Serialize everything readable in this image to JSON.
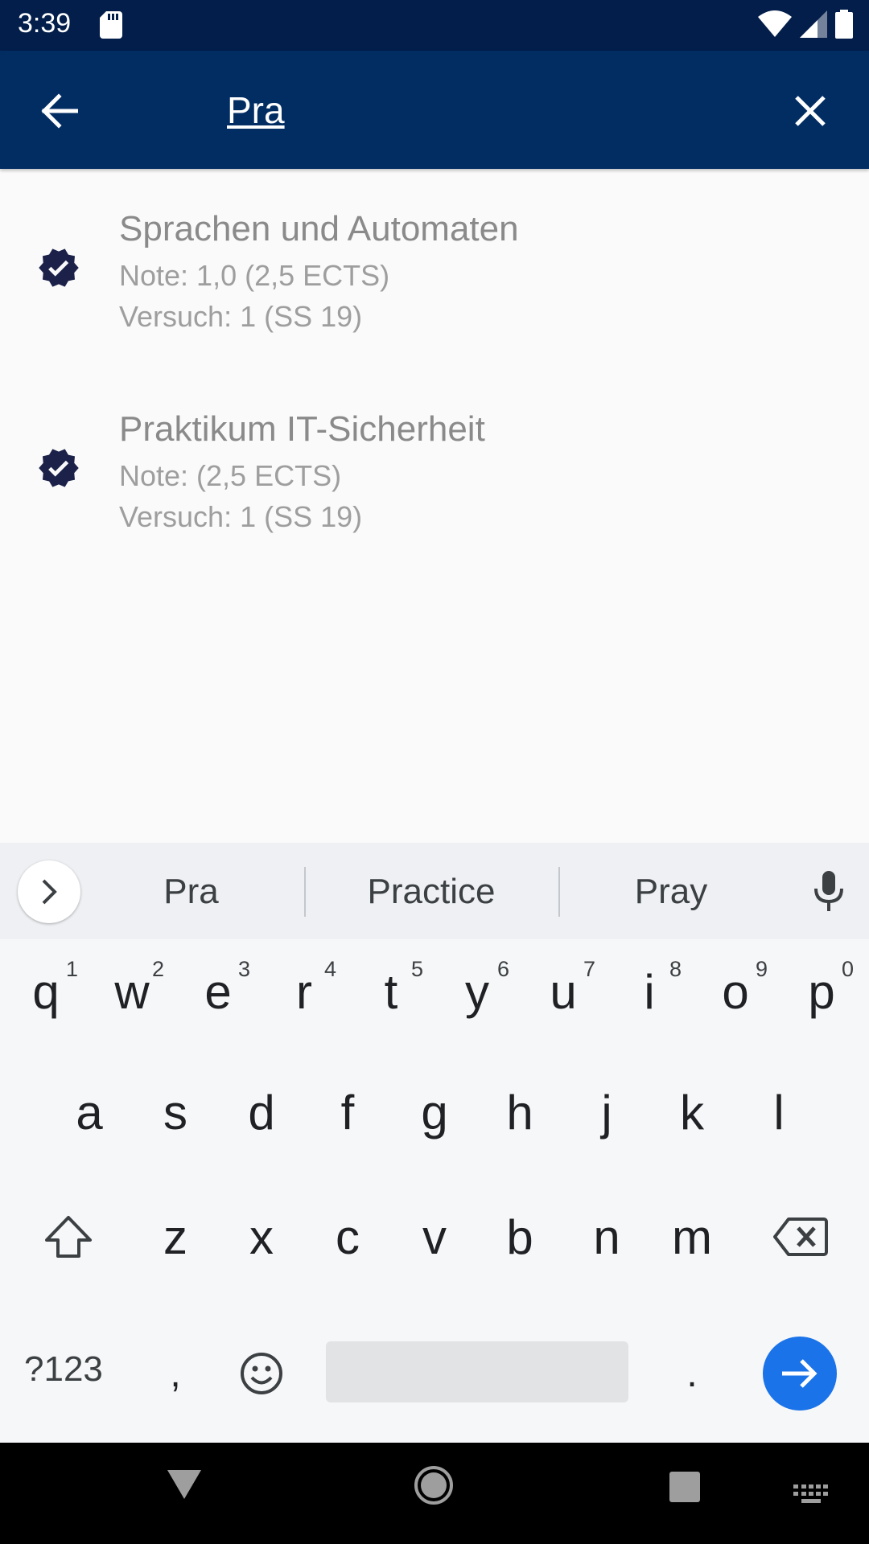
{
  "status_bar": {
    "time": "3:39"
  },
  "search": {
    "value": "Pra"
  },
  "results": [
    {
      "title": "Sprachen und Automaten",
      "grade": "Note: 1,0 (2,5 ECTS)",
      "attempt": "Versuch: 1 (SS 19)"
    },
    {
      "title": "Praktikum IT-Sicherheit",
      "grade": "Note:  (2,5 ECTS)",
      "attempt": "Versuch: 1 (SS 19)"
    }
  ],
  "suggestions": [
    "Pra",
    "Practice",
    "Pray"
  ],
  "keyboard": {
    "row1": [
      {
        "key": "q",
        "num": "1"
      },
      {
        "key": "w",
        "num": "2"
      },
      {
        "key": "e",
        "num": "3"
      },
      {
        "key": "r",
        "num": "4"
      },
      {
        "key": "t",
        "num": "5"
      },
      {
        "key": "y",
        "num": "6"
      },
      {
        "key": "u",
        "num": "7"
      },
      {
        "key": "i",
        "num": "8"
      },
      {
        "key": "o",
        "num": "9"
      },
      {
        "key": "p",
        "num": "0"
      }
    ],
    "row2": [
      "a",
      "s",
      "d",
      "f",
      "g",
      "h",
      "j",
      "k",
      "l"
    ],
    "row3": [
      "z",
      "x",
      "c",
      "v",
      "b",
      "n",
      "m"
    ],
    "symbols_label": "?123",
    "comma": ",",
    "period": "."
  },
  "colors": {
    "status_bar": "#031e4a",
    "app_bar": "#022d63",
    "verified_icon": "#1b2148",
    "enter_key": "#1a73e8"
  },
  "icons": {
    "back": "arrow-left-icon",
    "clear": "close-icon",
    "result": "verified-badge-icon",
    "expand": "chevron-right-icon",
    "mic": "mic-icon",
    "shift": "shift-icon",
    "backspace": "backspace-icon",
    "emoji": "emoji-icon",
    "enter": "arrow-right-icon"
  }
}
